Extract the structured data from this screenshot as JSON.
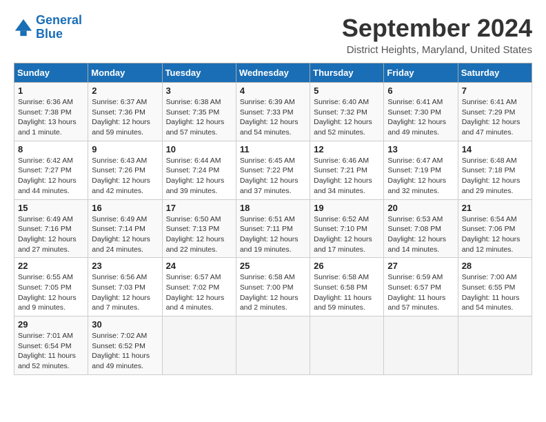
{
  "header": {
    "logo_line1": "General",
    "logo_line2": "Blue",
    "title": "September 2024",
    "subtitle": "District Heights, Maryland, United States"
  },
  "days_of_week": [
    "Sunday",
    "Monday",
    "Tuesday",
    "Wednesday",
    "Thursday",
    "Friday",
    "Saturday"
  ],
  "weeks": [
    [
      {
        "day": "1",
        "info": "Sunrise: 6:36 AM\nSunset: 7:38 PM\nDaylight: 13 hours\nand 1 minute."
      },
      {
        "day": "2",
        "info": "Sunrise: 6:37 AM\nSunset: 7:36 PM\nDaylight: 12 hours\nand 59 minutes."
      },
      {
        "day": "3",
        "info": "Sunrise: 6:38 AM\nSunset: 7:35 PM\nDaylight: 12 hours\nand 57 minutes."
      },
      {
        "day": "4",
        "info": "Sunrise: 6:39 AM\nSunset: 7:33 PM\nDaylight: 12 hours\nand 54 minutes."
      },
      {
        "day": "5",
        "info": "Sunrise: 6:40 AM\nSunset: 7:32 PM\nDaylight: 12 hours\nand 52 minutes."
      },
      {
        "day": "6",
        "info": "Sunrise: 6:41 AM\nSunset: 7:30 PM\nDaylight: 12 hours\nand 49 minutes."
      },
      {
        "day": "7",
        "info": "Sunrise: 6:41 AM\nSunset: 7:29 PM\nDaylight: 12 hours\nand 47 minutes."
      }
    ],
    [
      {
        "day": "8",
        "info": "Sunrise: 6:42 AM\nSunset: 7:27 PM\nDaylight: 12 hours\nand 44 minutes."
      },
      {
        "day": "9",
        "info": "Sunrise: 6:43 AM\nSunset: 7:26 PM\nDaylight: 12 hours\nand 42 minutes."
      },
      {
        "day": "10",
        "info": "Sunrise: 6:44 AM\nSunset: 7:24 PM\nDaylight: 12 hours\nand 39 minutes."
      },
      {
        "day": "11",
        "info": "Sunrise: 6:45 AM\nSunset: 7:22 PM\nDaylight: 12 hours\nand 37 minutes."
      },
      {
        "day": "12",
        "info": "Sunrise: 6:46 AM\nSunset: 7:21 PM\nDaylight: 12 hours\nand 34 minutes."
      },
      {
        "day": "13",
        "info": "Sunrise: 6:47 AM\nSunset: 7:19 PM\nDaylight: 12 hours\nand 32 minutes."
      },
      {
        "day": "14",
        "info": "Sunrise: 6:48 AM\nSunset: 7:18 PM\nDaylight: 12 hours\nand 29 minutes."
      }
    ],
    [
      {
        "day": "15",
        "info": "Sunrise: 6:49 AM\nSunset: 7:16 PM\nDaylight: 12 hours\nand 27 minutes."
      },
      {
        "day": "16",
        "info": "Sunrise: 6:49 AM\nSunset: 7:14 PM\nDaylight: 12 hours\nand 24 minutes."
      },
      {
        "day": "17",
        "info": "Sunrise: 6:50 AM\nSunset: 7:13 PM\nDaylight: 12 hours\nand 22 minutes."
      },
      {
        "day": "18",
        "info": "Sunrise: 6:51 AM\nSunset: 7:11 PM\nDaylight: 12 hours\nand 19 minutes."
      },
      {
        "day": "19",
        "info": "Sunrise: 6:52 AM\nSunset: 7:10 PM\nDaylight: 12 hours\nand 17 minutes."
      },
      {
        "day": "20",
        "info": "Sunrise: 6:53 AM\nSunset: 7:08 PM\nDaylight: 12 hours\nand 14 minutes."
      },
      {
        "day": "21",
        "info": "Sunrise: 6:54 AM\nSunset: 7:06 PM\nDaylight: 12 hours\nand 12 minutes."
      }
    ],
    [
      {
        "day": "22",
        "info": "Sunrise: 6:55 AM\nSunset: 7:05 PM\nDaylight: 12 hours\nand 9 minutes."
      },
      {
        "day": "23",
        "info": "Sunrise: 6:56 AM\nSunset: 7:03 PM\nDaylight: 12 hours\nand 7 minutes."
      },
      {
        "day": "24",
        "info": "Sunrise: 6:57 AM\nSunset: 7:02 PM\nDaylight: 12 hours\nand 4 minutes."
      },
      {
        "day": "25",
        "info": "Sunrise: 6:58 AM\nSunset: 7:00 PM\nDaylight: 12 hours\nand 2 minutes."
      },
      {
        "day": "26",
        "info": "Sunrise: 6:58 AM\nSunset: 6:58 PM\nDaylight: 11 hours\nand 59 minutes."
      },
      {
        "day": "27",
        "info": "Sunrise: 6:59 AM\nSunset: 6:57 PM\nDaylight: 11 hours\nand 57 minutes."
      },
      {
        "day": "28",
        "info": "Sunrise: 7:00 AM\nSunset: 6:55 PM\nDaylight: 11 hours\nand 54 minutes."
      }
    ],
    [
      {
        "day": "29",
        "info": "Sunrise: 7:01 AM\nSunset: 6:54 PM\nDaylight: 11 hours\nand 52 minutes."
      },
      {
        "day": "30",
        "info": "Sunrise: 7:02 AM\nSunset: 6:52 PM\nDaylight: 11 hours\nand 49 minutes."
      },
      {
        "day": "",
        "info": ""
      },
      {
        "day": "",
        "info": ""
      },
      {
        "day": "",
        "info": ""
      },
      {
        "day": "",
        "info": ""
      },
      {
        "day": "",
        "info": ""
      }
    ]
  ]
}
